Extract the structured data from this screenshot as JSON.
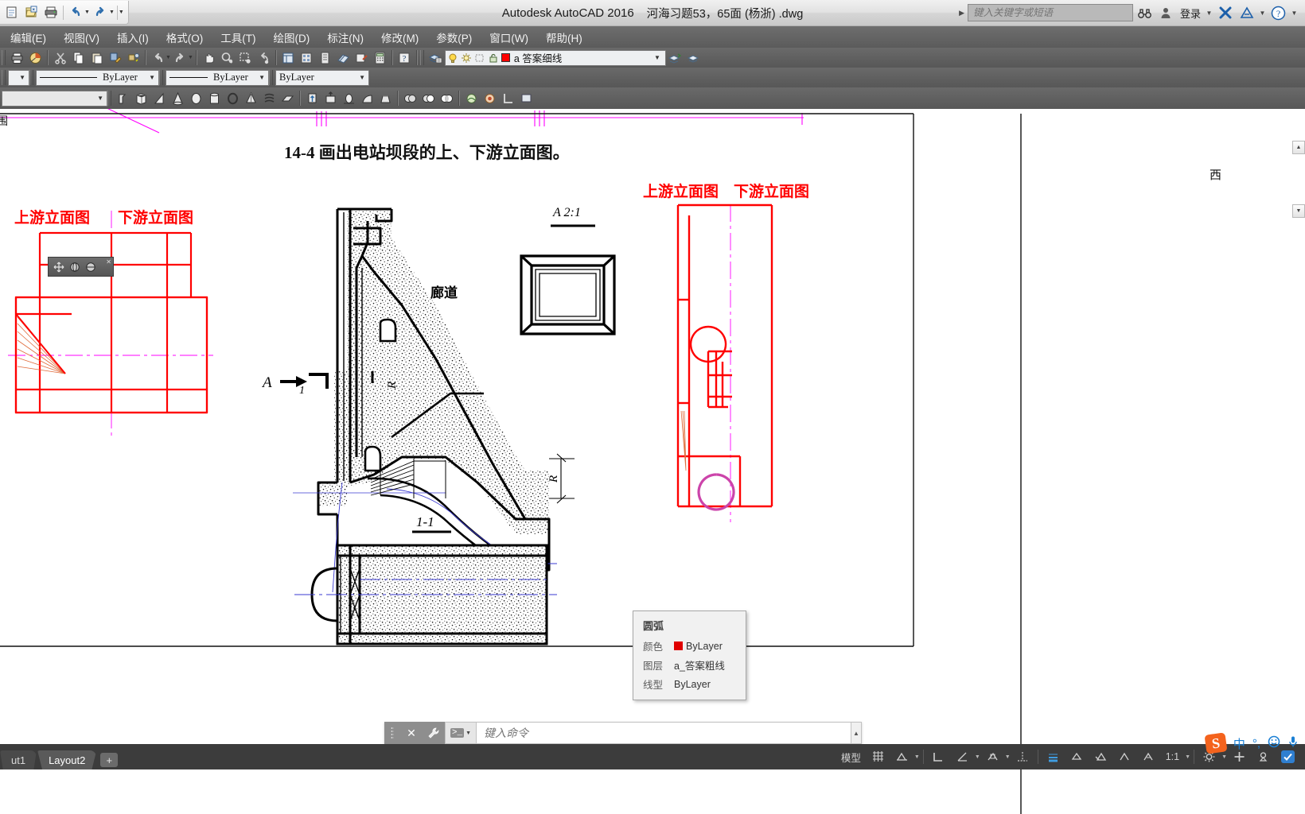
{
  "app": {
    "title": "Autodesk AutoCAD 2016",
    "filename": "河海习题53，65面 (杨浙) .dwg"
  },
  "quick_access": {
    "icons": [
      "new-icon",
      "open-icon",
      "save-icon",
      "plot-icon",
      "undo-icon",
      "redo-icon",
      "customize-icon"
    ]
  },
  "search": {
    "placeholder": "键入关键字或短语",
    "find_icon": "binoculars-icon",
    "sign_in_label": "登录",
    "exchange_icon": "autodesk-exchange-icon",
    "a360_icon": "a360-icon",
    "help_icon": "help-icon"
  },
  "menubar": {
    "items": [
      {
        "label": "编辑(E)",
        "name": "menu-edit"
      },
      {
        "label": "视图(V)",
        "name": "menu-view"
      },
      {
        "label": "插入(I)",
        "name": "menu-insert"
      },
      {
        "label": "格式(O)",
        "name": "menu-format"
      },
      {
        "label": "工具(T)",
        "name": "menu-tools"
      },
      {
        "label": "绘图(D)",
        "name": "menu-draw"
      },
      {
        "label": "标注(N)",
        "name": "menu-dimension"
      },
      {
        "label": "修改(M)",
        "name": "menu-modify"
      },
      {
        "label": "参数(P)",
        "name": "menu-parametric"
      },
      {
        "label": "窗口(W)",
        "name": "menu-window"
      },
      {
        "label": "帮助(H)",
        "name": "menu-help"
      }
    ]
  },
  "layer_toolbar": {
    "layer_name": "a 答案细线",
    "layer_color": "#ff0000",
    "layer_prefix_letter": "a",
    "icons": [
      "layer-properties-icon",
      "lightbulb-icon",
      "sun-freeze-icon",
      "freeze-vp-icon",
      "lock-icon"
    ],
    "trailing_icons": [
      "layer-previous-icon",
      "layer-state-icon"
    ]
  },
  "properties_toolbar": {
    "color_control": "ByLayer",
    "linetype_control": "ByLayer",
    "lineweight_control": "ByLayer"
  },
  "tooltip": {
    "title": "圆弧",
    "rows": [
      {
        "key": "颜色",
        "value": "ByLayer",
        "swatch": "#e00000"
      },
      {
        "key": "图层",
        "value": "a_答案粗线",
        "swatch": ""
      },
      {
        "key": "线型",
        "value": "ByLayer",
        "swatch": ""
      }
    ]
  },
  "drawing": {
    "title": "14-4 画出电站坝段的上、下游立面图。",
    "label_upstream_left": "上游立面图",
    "label_downstream_left": "下游立面图",
    "label_upstream_right": "上游立面图",
    "label_downstream_right": "下游立面图",
    "label_gallery": "廊道",
    "label_detail_a": "A 2:1",
    "label_section_11": "1-1",
    "label_section_marker_a": "A",
    "label_section_marker_1": "1",
    "label_radius_1": "R",
    "label_radius_2": "R",
    "label_edge_text": "西",
    "label_left_edge": "围"
  },
  "command_line": {
    "placeholder": "键入命令",
    "close_icon": "close-icon",
    "settings_icon": "wrench-icon",
    "prompt_icon": "command-prompt-icon",
    "scroll_icon": "scroll-up-icon"
  },
  "layout_tabs": {
    "tabs": [
      {
        "label": "ut1",
        "active": false,
        "name": "layout-tab-1"
      },
      {
        "label": "Layout2",
        "active": true,
        "name": "layout-tab-2"
      }
    ],
    "add_label": "+"
  },
  "status_bar": {
    "model_label": "模型",
    "scale": "1:1",
    "items": [
      {
        "name": "grid-display-toggle",
        "icon": "grid-icon"
      },
      {
        "name": "snap-mode-toggle",
        "icon": "snap-icon"
      },
      {
        "name": "ortho-mode-toggle",
        "icon": "ortho-icon"
      },
      {
        "name": "polar-tracking-toggle",
        "icon": "polar-icon"
      },
      {
        "name": "object-snap-toggle",
        "icon": "osnap-icon"
      },
      {
        "name": "otrack-toggle",
        "icon": "otrack-icon"
      },
      {
        "name": "lineweight-toggle",
        "icon": "lineweight-icon"
      },
      {
        "name": "transparency-toggle",
        "icon": "transparency-icon"
      },
      {
        "name": "selection-cycling-toggle",
        "icon": "cycle-icon"
      },
      {
        "name": "annotation-visibility-toggle",
        "icon": "annot-visibility-icon"
      },
      {
        "name": "autoscale-toggle",
        "icon": "autoscale-icon"
      },
      {
        "name": "annotation-scale",
        "icon": "scale-icon"
      },
      {
        "name": "workspace-switch",
        "icon": "gear-icon"
      },
      {
        "name": "hardware-accel-toggle",
        "icon": "plus-icon"
      },
      {
        "name": "isolate-objects",
        "icon": "isolate-icon"
      },
      {
        "name": "customization",
        "icon": "customize-icon"
      }
    ]
  },
  "ime_tray": {
    "logo": "S",
    "mode_label": "中",
    "icons": [
      "sogou-logo-icon",
      "chinese-mode-icon",
      "punctuation-icon",
      "emoji-icon",
      "voice-icon"
    ]
  }
}
